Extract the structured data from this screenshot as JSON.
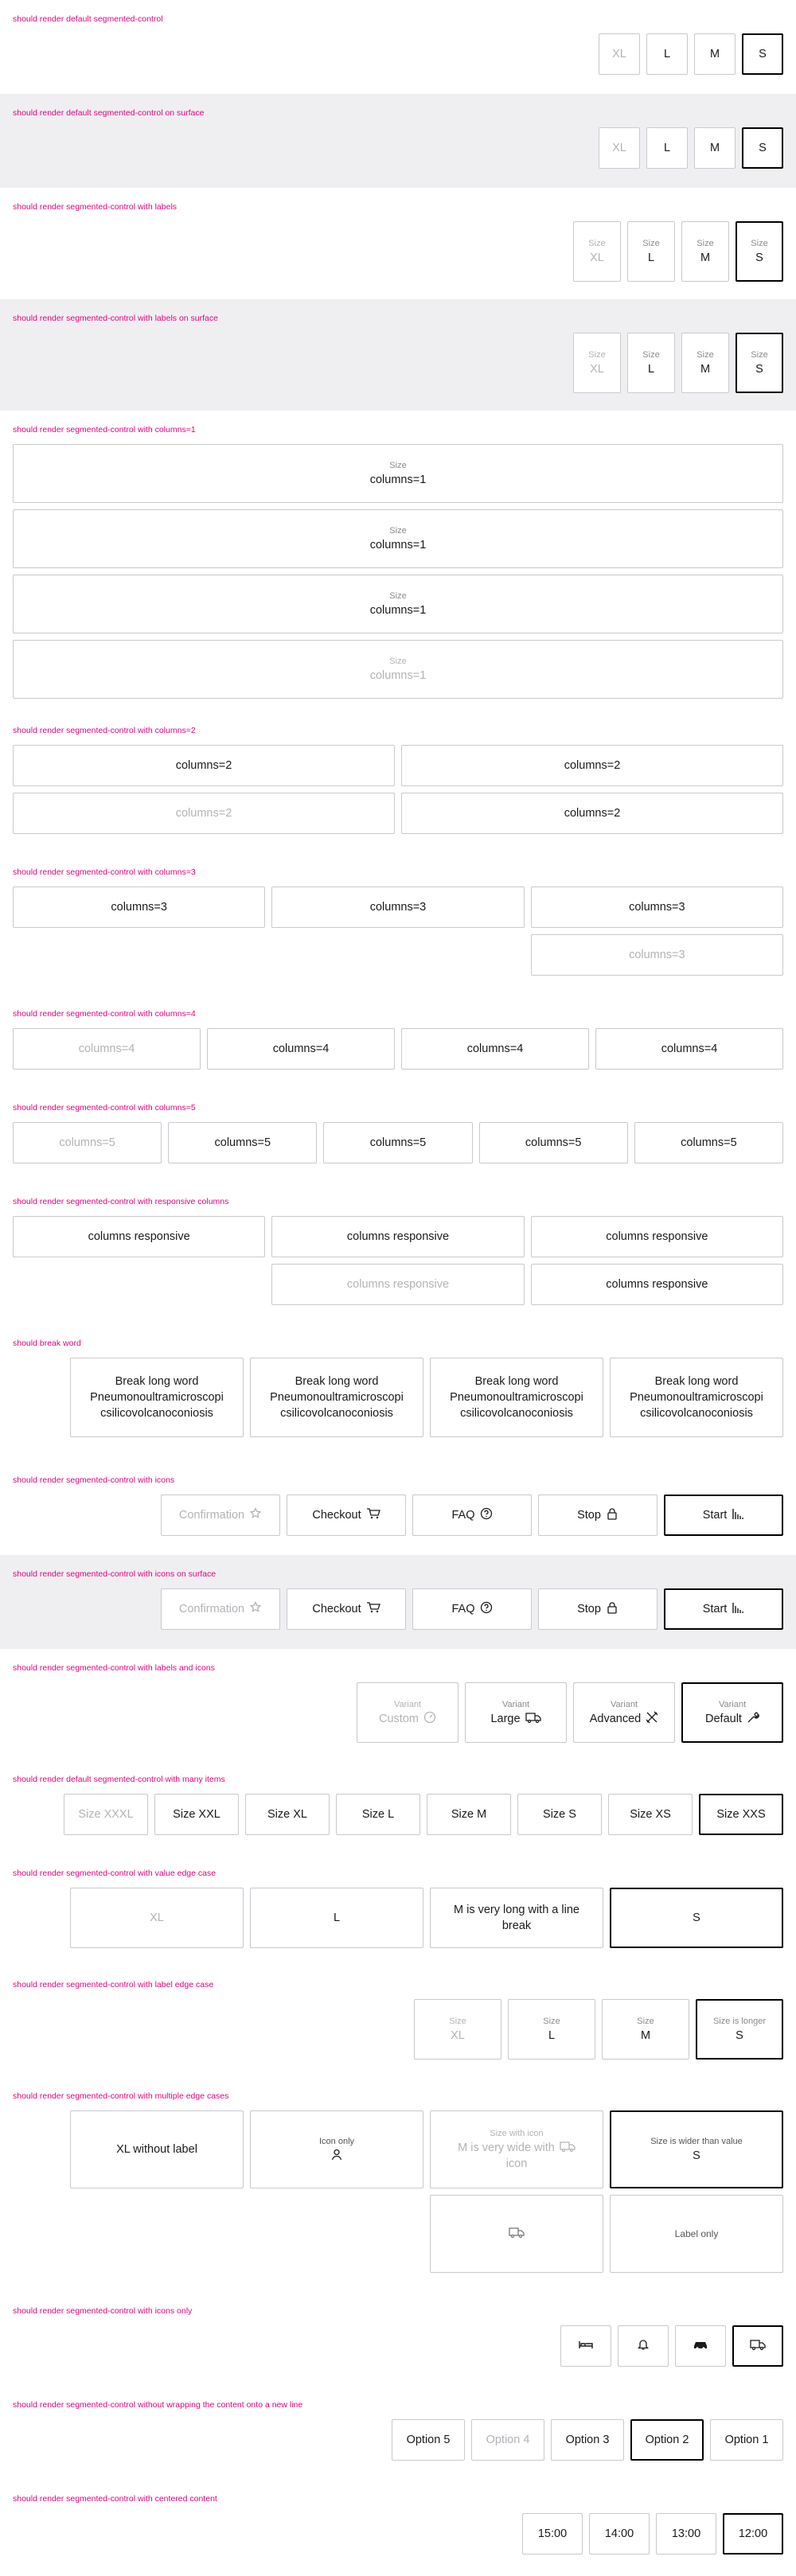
{
  "s1": {
    "title": "should render default segmented-control",
    "items": [
      "XL",
      "L",
      "M",
      "S"
    ]
  },
  "s2": {
    "title": "should render default segmented-control on surface",
    "items": [
      "XL",
      "L",
      "M",
      "S"
    ]
  },
  "s3": {
    "title": "should render segmented-control with labels",
    "label": "Size",
    "items": [
      "XL",
      "L",
      "M",
      "S"
    ]
  },
  "s4": {
    "title": "should render segmented-control with labels on surface",
    "label": "Size",
    "items": [
      "XL",
      "L",
      "M",
      "S"
    ]
  },
  "s5": {
    "title": "should render segmented-control with columns=1",
    "label": "Size",
    "value": "columns=1"
  },
  "s6": {
    "title": "should render segmented-control with columns=2",
    "value": "columns=2"
  },
  "s7": {
    "title": "should render segmented-control with columns=3",
    "value": "columns=3"
  },
  "s8": {
    "title": "should render segmented-control with columns=4",
    "value": "columns=4"
  },
  "s9": {
    "title": "should render segmented-control with columns=5",
    "value": "columns=5"
  },
  "s10": {
    "title": "should render segmented-control with responsive columns",
    "value": "columns responsive"
  },
  "s11": {
    "title": "should break word",
    "line1": "Break long word",
    "line2": "Pneumonoultramicroscopi",
    "line3": "csilicovolcanoconiosis"
  },
  "s12": {
    "title": "should render segmented-control with icons",
    "items": [
      "Confirmation",
      "Checkout",
      "FAQ",
      "Stop",
      "Start"
    ]
  },
  "s13": {
    "title": "should render segmented-control with icons on surface",
    "items": [
      "Confirmation",
      "Checkout",
      "FAQ",
      "Stop",
      "Start"
    ]
  },
  "s14": {
    "title": "should render segmented-control with labels and icons",
    "label": "Variant",
    "items": [
      "Custom",
      "Large",
      "Advanced",
      "Default"
    ]
  },
  "s15": {
    "title": "should render default segmented-control with many items",
    "items": [
      "Size XXXL",
      "Size XXL",
      "Size XL",
      "Size L",
      "Size M",
      "Size S",
      "Size XS",
      "Size XXS"
    ]
  },
  "s16": {
    "title": "should render segmented-control with value edge case",
    "items": [
      "XL",
      "L",
      "M is very long with a line break",
      "S"
    ]
  },
  "s17": {
    "title": "should render segmented-control with label edge case",
    "labels": [
      "Size",
      "Size",
      "Size",
      "Size is longer"
    ],
    "items": [
      "XL",
      "L",
      "M",
      "S"
    ]
  },
  "s18": {
    "title": "should render segmented-control with multiple edge cases",
    "xl": "XL without label",
    "icon_only": "Icon only",
    "m_label": "Size with icon",
    "m_value": "M is very wide with",
    "m_value2": "icon",
    "s_label": "Size is wider than value",
    "s_value": "S",
    "label_only": "Label only"
  },
  "s19": {
    "title": "should render segmented-control with icons only"
  },
  "s20": {
    "title": "should render segmented-control without wrapping the content onto a new line",
    "items": [
      "Option 5",
      "Option 4",
      "Option 3",
      "Option 2",
      "Option 1"
    ]
  },
  "s21": {
    "title": "should render segmented-control with centered content",
    "items": [
      "15:00",
      "14:00",
      "13:00",
      "12:00"
    ]
  },
  "colors": {
    "accent": "#e6007e",
    "border": "#c9c9cf",
    "selected": "#000000",
    "surface": "#efeff2",
    "disabled": "#b3b3b8"
  }
}
